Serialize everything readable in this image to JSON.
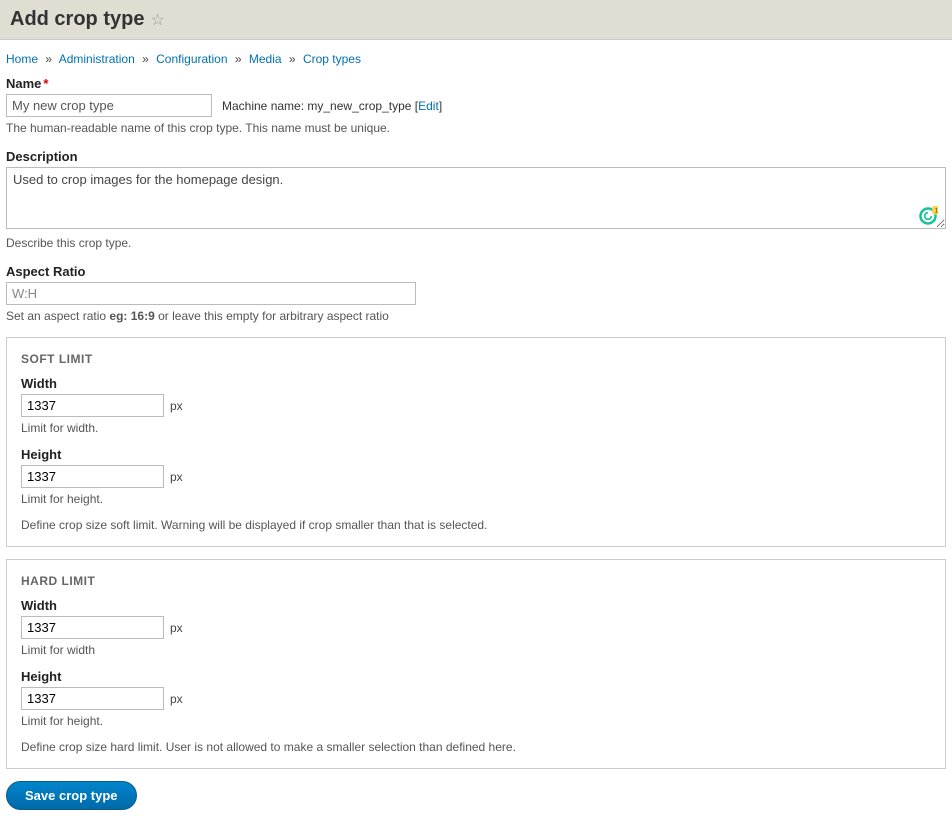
{
  "header": {
    "title": "Add crop type"
  },
  "breadcrumbs": {
    "items": [
      "Home",
      "Administration",
      "Configuration",
      "Media",
      "Crop types"
    ]
  },
  "name": {
    "label": "Name",
    "value": "My new crop type",
    "machine_prefix": "Machine name:",
    "machine_name": "my_new_crop_type",
    "edit_label": "Edit",
    "help": "The human-readable name of this crop type. This name must be unique."
  },
  "description": {
    "label": "Description",
    "value": "Used to crop images for the homepage design.",
    "help": "Describe this crop type."
  },
  "aspect": {
    "label": "Aspect Ratio",
    "placeholder": "W:H",
    "help_pre": "Set an aspect ratio ",
    "help_bold": "eg: 16:9",
    "help_post": " or leave this empty for arbitrary aspect ratio"
  },
  "soft_limit": {
    "title": "SOFT LIMIT",
    "width_label": "Width",
    "width_value": "1337",
    "width_help": "Limit for width.",
    "height_label": "Height",
    "height_value": "1337",
    "height_help": "Limit for height.",
    "suffix": "px",
    "desc": "Define crop size soft limit. Warning will be displayed if crop smaller than that is selected."
  },
  "hard_limit": {
    "title": "HARD LIMIT",
    "width_label": "Width",
    "width_value": "1337",
    "width_help": "Limit for width",
    "height_label": "Height",
    "height_value": "1337",
    "height_help": "Limit for height.",
    "suffix": "px",
    "desc": "Define crop size hard limit. User is not allowed to make a smaller selection than defined here."
  },
  "submit": {
    "label": "Save crop type"
  },
  "grammarly_badge": "1"
}
